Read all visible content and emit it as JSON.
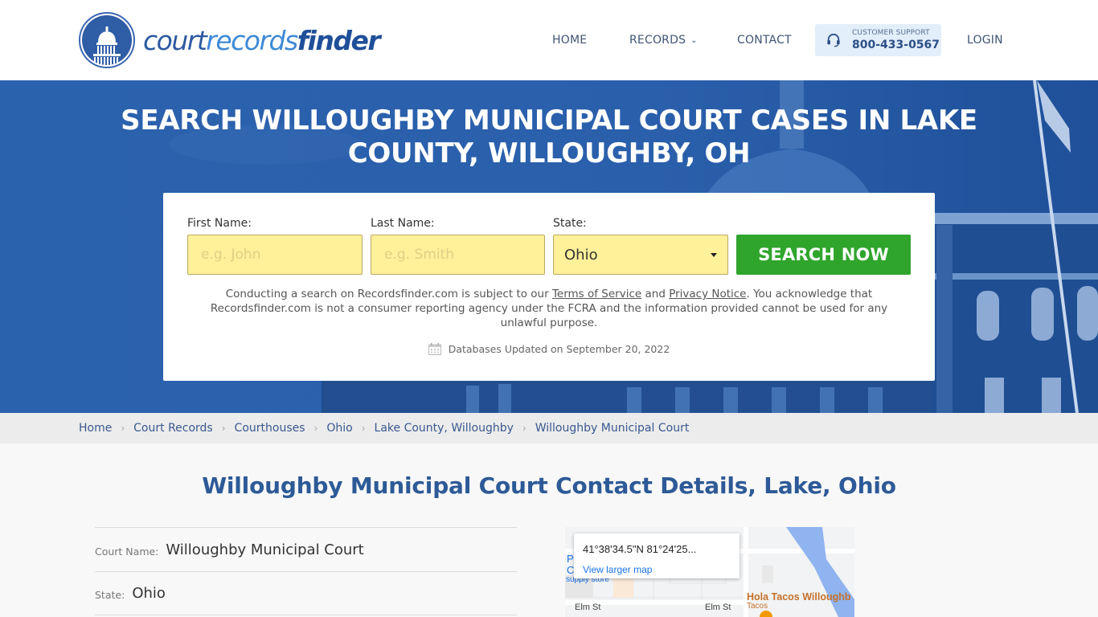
{
  "header": {
    "logo": {
      "part1": "court",
      "part2": "records",
      "part3": "finder"
    },
    "nav": [
      {
        "label": "HOME"
      },
      {
        "label": "RECORDS",
        "has_dropdown": true
      },
      {
        "label": "CONTACT"
      }
    ],
    "support": {
      "label": "CUSTOMER SUPPORT",
      "phone": "800-433-0567",
      "icon": "headset-icon"
    },
    "login_label": "LOGIN"
  },
  "hero": {
    "title": "SEARCH WILLOUGHBY MUNICIPAL COURT CASES IN LAKE COUNTY, WILLOUGHBY, OH"
  },
  "search_form": {
    "first_name": {
      "label": "First Name:",
      "placeholder": "e.g. John",
      "value": ""
    },
    "last_name": {
      "label": "Last Name:",
      "placeholder": "e.g. Smith",
      "value": ""
    },
    "state": {
      "label": "State:",
      "selected": "Ohio"
    },
    "submit_label": "SEARCH NOW",
    "disclaimer": {
      "prefix": "Conducting a search on Recordsfinder.com is subject to our ",
      "terms_link": "Terms of Service",
      "and": " and ",
      "privacy_link": "Privacy Notice",
      "suffix": ". You acknowledge that Recordsfinder.com is not a consumer reporting agency under the FCRA and the information provided cannot be used for any unlawful purpose."
    },
    "db_updated": "Databases Updated on September 20, 2022"
  },
  "breadcrumb": [
    "Home",
    "Court Records",
    "Courthouses",
    "Ohio",
    "Lake County, Willoughby",
    "Willoughby Municipal Court"
  ],
  "content": {
    "title": "Willoughby Municipal Court Contact Details, Lake, Ohio",
    "details": [
      {
        "label": "Court Name:",
        "value": "Willoughby Municipal Court"
      },
      {
        "label": "State:",
        "value": "Ohio"
      }
    ]
  },
  "map": {
    "coordinates": "41°38'34.5\"N 81°24'25...",
    "view_larger_label": "View larger map",
    "streets": [
      "Elm St",
      "Elm St"
    ],
    "poi_left_partial": [
      "P",
      "C"
    ],
    "poi_left_sub": "supply store",
    "poi_right_name": "Hola Tacos Willoughb",
    "poi_right_category": "Tacos"
  },
  "colors": {
    "brand_blue": "#2d5aa0",
    "hero_blue": "#2a5ea9",
    "cta_green": "#2fa52c",
    "input_yellow": "#fff09a",
    "support_bg": "#e3eefb",
    "link_blue": "#39598f"
  }
}
